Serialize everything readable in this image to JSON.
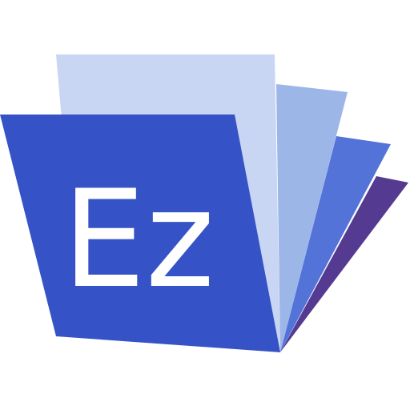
{
  "logo": {
    "icon": "ez-folder-pages-icon",
    "text": "Ez",
    "colors": {
      "front_folder": "#3553c6",
      "page_light": "#c9d6f3",
      "page_mid": "#9db6e8",
      "page_blue": "#5473d8",
      "page_purple": "#553a92",
      "text": "#ffffff",
      "background": "#ffffff"
    }
  }
}
